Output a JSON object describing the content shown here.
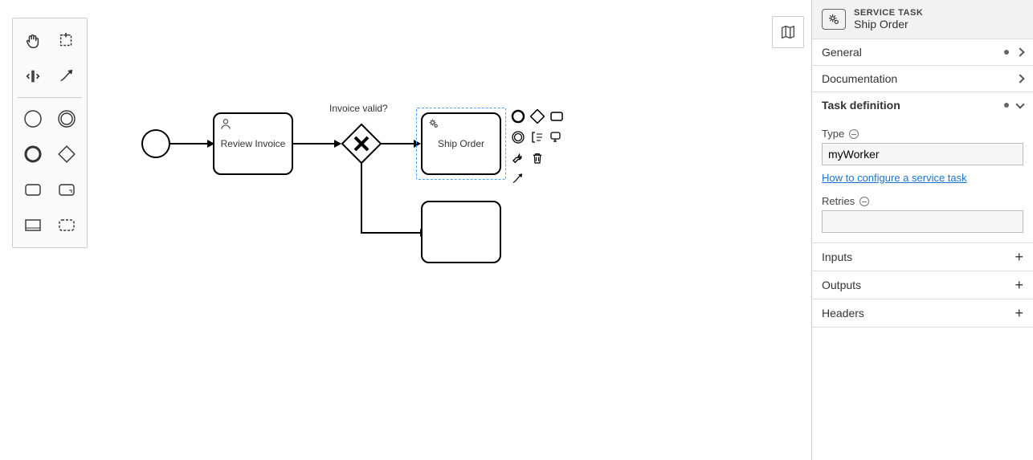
{
  "canvas": {
    "gateway_label": "Invoice valid?",
    "tasks": {
      "review_invoice": "Review Invoice",
      "ship_order": "Ship Order"
    }
  },
  "panel": {
    "header_type": "SERVICE TASK",
    "header_name": "Ship Order",
    "sections": {
      "general": "General",
      "documentation": "Documentation",
      "task_definition": "Task definition",
      "inputs": "Inputs",
      "outputs": "Outputs",
      "headers": "Headers"
    },
    "task_def": {
      "type_label": "Type",
      "type_value": "myWorker",
      "help_link": "How to configure a service task",
      "retries_label": "Retries",
      "retries_value": ""
    }
  }
}
